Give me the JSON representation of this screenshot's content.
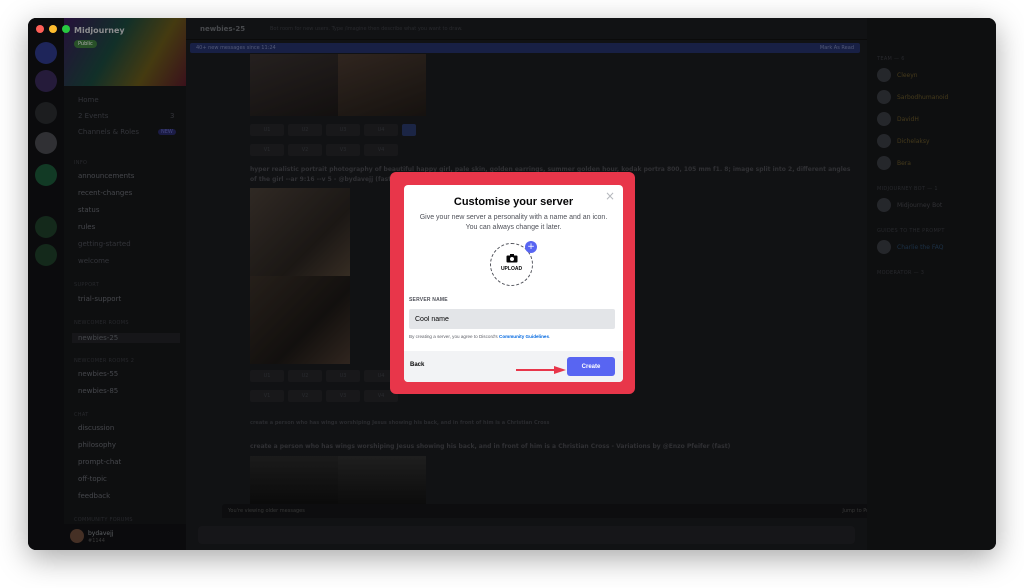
{
  "app": {
    "server_name": "Midjourney",
    "server_badge": "Public"
  },
  "channels": {
    "home": "Home",
    "events": "2 Events",
    "events_count": "3",
    "browse": "Channels & Roles",
    "browse_badge": "NEW",
    "info_category": "INFO",
    "info": [
      "announcements",
      "recent-changes",
      "status",
      "rules",
      "getting-started",
      "welcome"
    ],
    "support_category": "SUPPORT",
    "support": [
      "trial-support"
    ],
    "newcomer_category": "NEWCOMER ROOMS",
    "newcomer": [
      "newbies-25"
    ],
    "newcomer2_category": "NEWCOMER ROOMS 2",
    "newcomer2": [
      "newbies-55",
      "newbies-85"
    ],
    "chat_category": "CHAT",
    "chat": [
      "discussion",
      "philosophy",
      "prompt-chat",
      "off-topic",
      "feedback"
    ],
    "forums_category": "COMMUNITY FORUMS"
  },
  "user": {
    "name": "bydavejj",
    "status": "#1144"
  },
  "topbar": {
    "channel": "newbies-25",
    "description": "Bot room for new users. Type /imagine then describe what you want to draw.",
    "search_placeholder": "Search"
  },
  "banner": {
    "text": "40+ new messages since 11:24",
    "action": "Mark As Read"
  },
  "grid_buttons": {
    "upscale": [
      "U1",
      "U2",
      "U3",
      "U4"
    ],
    "variation": [
      "V1",
      "V2",
      "V3",
      "V4"
    ]
  },
  "messages": [
    {
      "text": "hyper realistic portrait photography of beautiful happy girl, pale skin, golden earrings, summer golden hour, kodak portra 800, 105 mm f1. 8; image split into 2, different angles"
    },
    {
      "text": "of the girl --ar 9:16 --v 5 - @bydavejj (fast)"
    },
    {
      "text": "create a person who has wings worshiping Jesus showing his back, and in front of him is a Christian Cross"
    },
    {
      "text": "create a person who has wings worshiping Jesus showing his back, and in front of him is a Christian Cross - Variations by @Enzo Pfeifer (fast)"
    }
  ],
  "composer": {
    "older_notice": "You're viewing older messages",
    "jump": "Jump to Present"
  },
  "members": {
    "team_heading": "TEAM — 6",
    "names": [
      "Cleeyn",
      "Sarbodhumanoid",
      "DavidH",
      "Dichelaksy",
      "Bera"
    ],
    "bot_heading": "MIDJOURNEY BOT — 1",
    "bot": "Midjourney Bot",
    "guides_heading": "GUIDES TO THE PROMPT",
    "guide": "Charlie the FAQ",
    "mod_heading": "MODERATOR — 3"
  },
  "modal": {
    "title": "Customise your server",
    "subtitle": "Give your new server a personality with a name and an icon. You can always change it later.",
    "upload_label": "UPLOAD",
    "name_label": "SERVER NAME",
    "name_value": "Cool name",
    "terms_prefix": "By creating a server, you agree to Discord's ",
    "terms_link": "Community Guidelines",
    "terms_suffix": ".",
    "back": "Back",
    "create": "Create"
  },
  "colors": {
    "accent": "#5865f2",
    "highlight_frame": "#e8364a"
  }
}
